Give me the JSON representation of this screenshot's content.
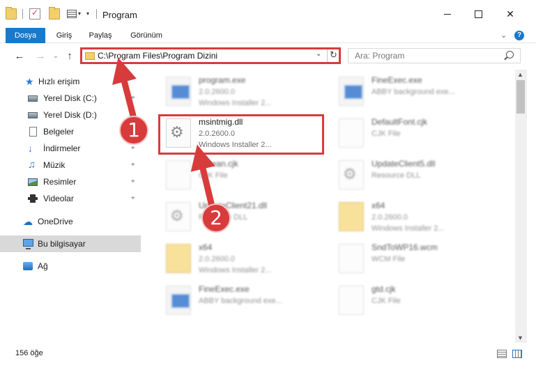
{
  "window": {
    "title": "Program",
    "minimize": "",
    "maximize": "",
    "close": "✕"
  },
  "ribbon": {
    "tabs": [
      "Dosya",
      "Giriş",
      "Paylaş",
      "Görünüm"
    ],
    "help": "?",
    "collapse": "⌄"
  },
  "nav": {
    "back": "←",
    "forward": "→",
    "up": "↑",
    "recent": "⌄",
    "address": "C:\\Program Files\\Program Dizini",
    "search_placeholder": "Ara: Program"
  },
  "sidebar": {
    "items": [
      {
        "label": "Hızlı erişim",
        "icon": "star-icon",
        "pinned": false
      },
      {
        "label": "Yerel Disk (C:)",
        "icon": "drive-icon",
        "pinned": true
      },
      {
        "label": "Yerel Disk (D:)",
        "icon": "drive-icon",
        "pinned": true
      },
      {
        "label": "Belgeler",
        "icon": "document-icon",
        "pinned": true
      },
      {
        "label": "İndirmeler",
        "icon": "download-icon",
        "pinned": true
      },
      {
        "label": "Müzik",
        "icon": "music-icon",
        "pinned": true
      },
      {
        "label": "Resimler",
        "icon": "pictures-icon",
        "pinned": true
      },
      {
        "label": "Videolar",
        "icon": "video-icon",
        "pinned": true
      },
      {
        "label": "OneDrive",
        "icon": "cloud-icon",
        "pinned": false
      },
      {
        "label": "Bu bilgisayar",
        "icon": "computer-icon",
        "pinned": false
      },
      {
        "label": "Ağ",
        "icon": "network-icon",
        "pinned": false
      }
    ],
    "selected": "Bu bilgisayar",
    "pin_glyph": "⌖"
  },
  "files": [
    {
      "name": "program.exe",
      "line1": "2.0.2600.0",
      "line2": "Windows Installer 2...",
      "kind": "exe",
      "blurred": true
    },
    {
      "name": "FineExec.exe",
      "line1": "ABBY background exe...",
      "line2": "",
      "kind": "exe",
      "blurred": true
    },
    {
      "name": "msintmig.dll",
      "line1": "2.0.2600.0",
      "line2": "Windows Installer 2...",
      "kind": "gear",
      "blurred": false
    },
    {
      "name": "DefaultFont.cjk",
      "line1": "CJK File",
      "line2": "",
      "kind": "blank",
      "blurred": true
    },
    {
      "name": "Korean.cjk",
      "line1": "CJK File",
      "line2": "",
      "kind": "blank",
      "blurred": true
    },
    {
      "name": "UpdateClient5.dll",
      "line1": "Resource DLL",
      "line2": "",
      "kind": "gear",
      "blurred": true
    },
    {
      "name": "UpdateClient21.dll",
      "line1": "Resource DLL",
      "line2": "",
      "kind": "gear",
      "blurred": true
    },
    {
      "name": "x64",
      "line1": "2.0.2600.0",
      "line2": "Windows Installer 2...",
      "kind": "folder",
      "blurred": true
    },
    {
      "name": "x64",
      "line1": "2.0.2600.0",
      "line2": "Windows Installer 2...",
      "kind": "folder",
      "blurred": true
    },
    {
      "name": "SndToWP16.wcm",
      "line1": "WCM File",
      "line2": "",
      "kind": "blank",
      "blurred": true
    },
    {
      "name": "FineExec.exe",
      "line1": "ABBY background exe...",
      "line2": "",
      "kind": "exe",
      "blurred": true
    },
    {
      "name": "gtd.cjk",
      "line1": "CJK File",
      "line2": "",
      "kind": "blank",
      "blurred": true
    }
  ],
  "status": {
    "count": "156 öğe"
  },
  "annotations": {
    "step1": "1",
    "step2": "2",
    "color": "#d83b3b"
  },
  "colors": {
    "accent": "#1979ca",
    "selected_bg": "#d9d9d9",
    "annotation_red": "#d83b3b"
  }
}
